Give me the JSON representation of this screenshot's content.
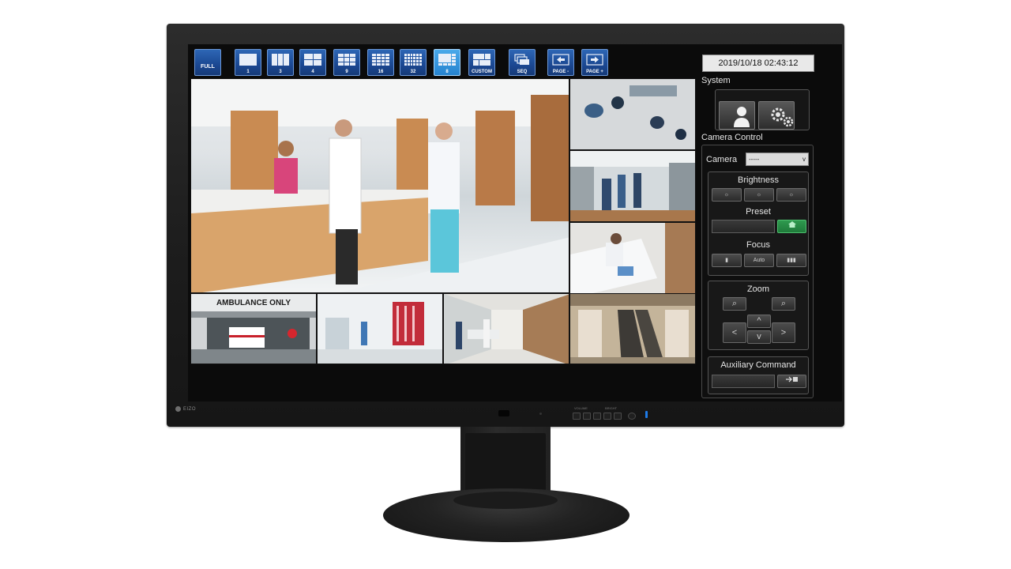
{
  "toolbar": {
    "buttons": [
      {
        "label": "FULL",
        "icon": "fullscreen-icon"
      },
      {
        "label": "1",
        "icon": "layout-1-icon"
      },
      {
        "label": "3",
        "icon": "layout-3-icon"
      },
      {
        "label": "4",
        "icon": "layout-4-icon"
      },
      {
        "label": "9",
        "icon": "layout-9-icon"
      },
      {
        "label": "16",
        "icon": "layout-16-icon"
      },
      {
        "label": "32",
        "icon": "layout-32-icon"
      },
      {
        "label": "8",
        "icon": "layout-8-icon",
        "active": true
      },
      {
        "label": "CUSTOM",
        "icon": "layout-custom-icon"
      },
      {
        "label": "SEQ",
        "icon": "sequence-icon"
      },
      {
        "label": "PAGE -",
        "icon": "arrow-left-icon"
      },
      {
        "label": "PAGE +",
        "icon": "arrow-right-icon"
      }
    ]
  },
  "cameras": [
    {
      "scene": "hospital-reception"
    },
    {
      "scene": "waiting-area-overhead"
    },
    {
      "scene": "corridor-staff"
    },
    {
      "scene": "patient-room"
    },
    {
      "scene": "ambulance-entrance",
      "sign": "AMBULANCE ONLY"
    },
    {
      "scene": "ward-corridor"
    },
    {
      "scene": "hallway-gurney"
    },
    {
      "scene": "atrium-escalators"
    }
  ],
  "panel": {
    "datetime": "2019/10/18 02:43:12",
    "system_title": "System",
    "camera_control_title": "Camera Control",
    "camera_label": "Camera",
    "camera_select_value": "-----",
    "brightness_label": "Brightness",
    "preset_label": "Preset",
    "focus_label": "Focus",
    "focus_auto": "Auto",
    "zoom_label": "Zoom",
    "aux_label": "Auxiliary Command"
  },
  "hardware": {
    "brand": "EIZO",
    "volume_label": "VOLUME",
    "bright_label": "BRIGHT"
  },
  "colors": {
    "toolbar_button": "#1b4892",
    "toolbar_active": "#2683cf",
    "preset_home": "#1f7a3a",
    "power_led": "#1e7be8"
  }
}
